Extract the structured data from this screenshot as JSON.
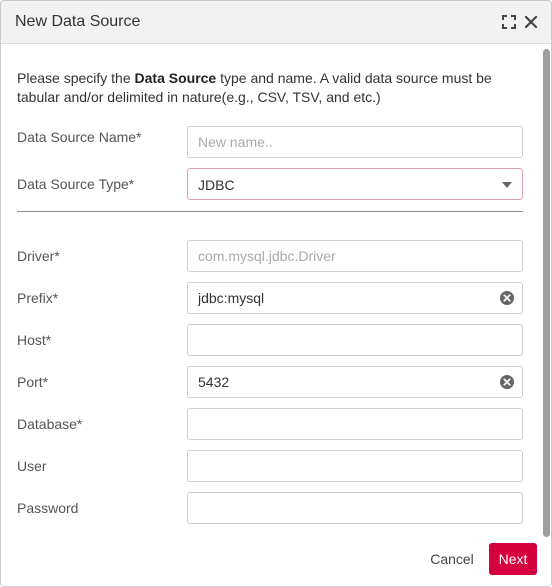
{
  "dialog": {
    "title": "New Data Source",
    "description_prefix": "Please specify the ",
    "description_bold": "Data Source",
    "description_suffix": " type and name. A valid data source must be tabular and/or delimited in nature(e.g., CSV, TSV, and etc.)"
  },
  "fields": {
    "name": {
      "label": "Data Source Name*",
      "value": "",
      "placeholder": "New name.."
    },
    "type": {
      "label": "Data Source Type*",
      "value": "JDBC"
    },
    "driver": {
      "label": "Driver*",
      "value": "",
      "placeholder": "com.mysql.jdbc.Driver"
    },
    "prefix": {
      "label": "Prefix*",
      "value": "jdbc:mysql"
    },
    "host": {
      "label": "Host*",
      "value": ""
    },
    "port": {
      "label": "Port*",
      "value": "5432"
    },
    "database": {
      "label": "Database*",
      "value": ""
    },
    "user": {
      "label": "User",
      "value": ""
    },
    "password": {
      "label": "Password",
      "value": ""
    }
  },
  "footer": {
    "cancel_label": "Cancel",
    "next_label": "Next"
  },
  "colors": {
    "accent": "#d6003f",
    "select_border": "#d9a3ad",
    "titlebar": "#f2f2f2"
  },
  "icons": {
    "expand": "expand-icon",
    "close": "close-icon",
    "clear": "clear-circle-icon",
    "caret": "caret-down-icon"
  }
}
